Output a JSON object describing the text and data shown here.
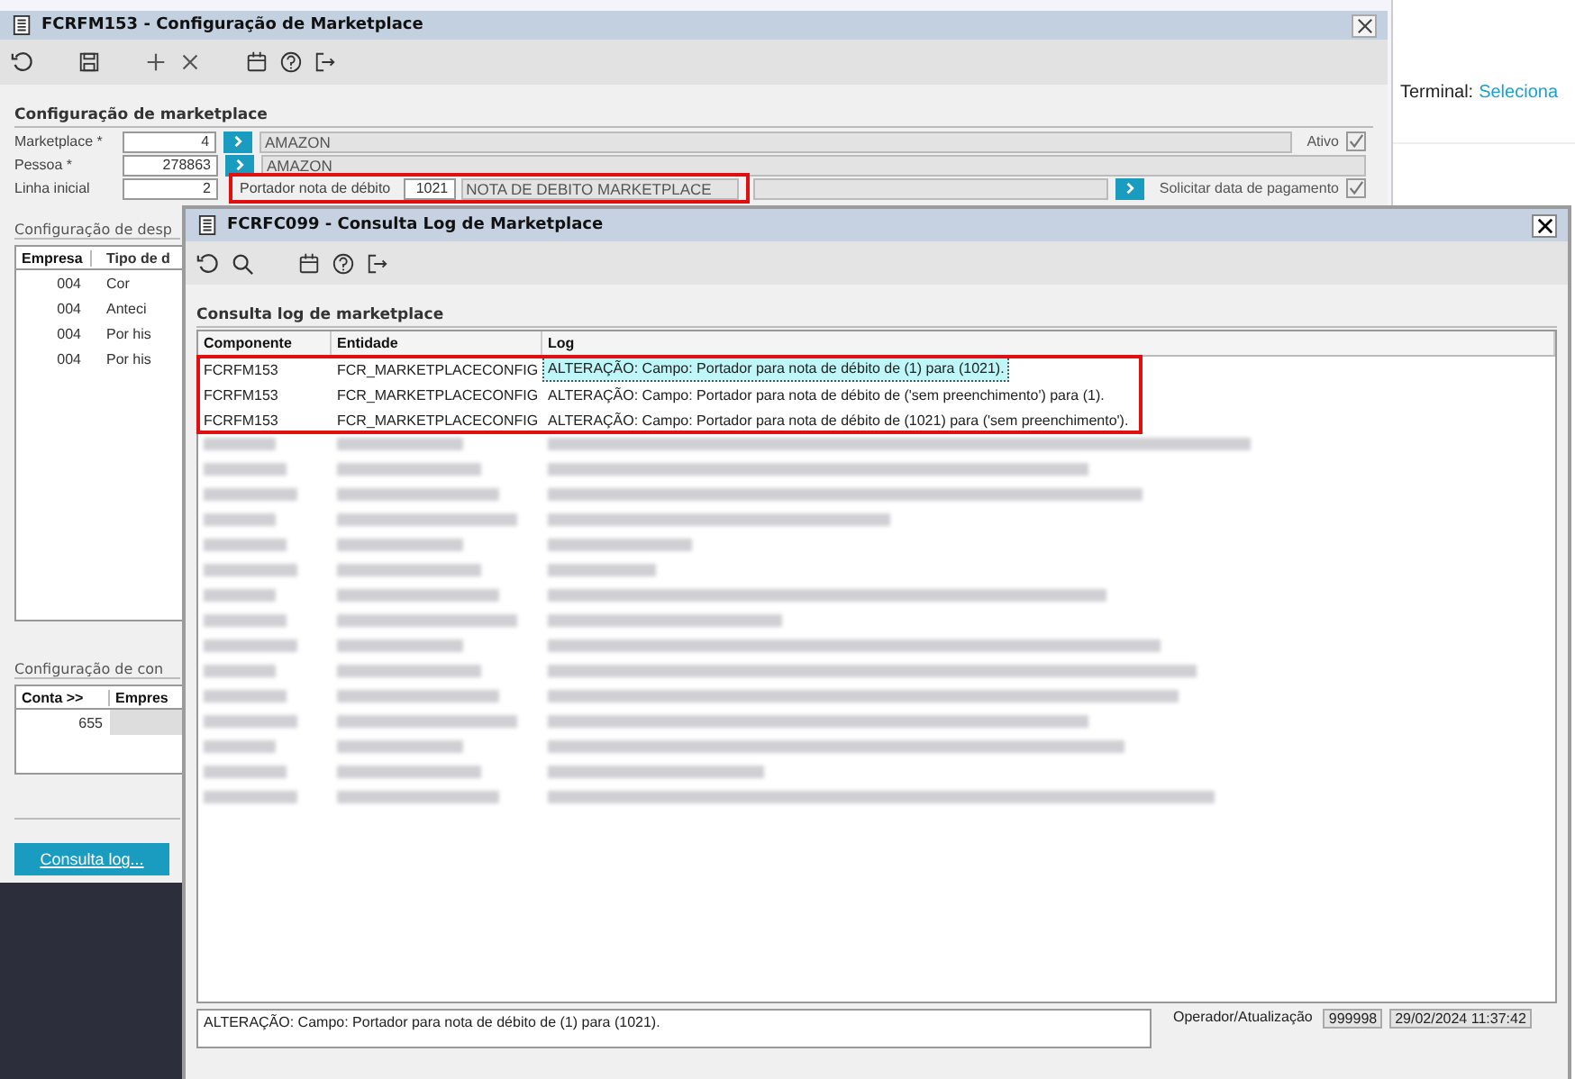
{
  "main_window": {
    "title": "FCRFM153 - Configuração de Marketplace",
    "section_title": "Configuração de marketplace",
    "marketplace": {
      "label": "Marketplace *",
      "value": "4",
      "name": "AMAZON"
    },
    "pessoa": {
      "label": "Pessoa *",
      "value": "278863",
      "name": "AMAZON"
    },
    "linha_inicial": {
      "label": "Linha inicial",
      "value": "2"
    },
    "portador": {
      "label": "Portador nota de débito",
      "value": "1021",
      "name": "NOTA DE DEBITO MARKETPLACE",
      "highlighted": true
    },
    "ativo": {
      "label": "Ativo",
      "checked": true
    },
    "solicitar": {
      "label": "Solicitar data de pagamento",
      "checked": true
    },
    "despesas": {
      "title": "Configuração de desp",
      "columns": [
        "Empresa",
        "Tipo de d"
      ],
      "rows": [
        [
          "004",
          "Cor"
        ],
        [
          "004",
          "Anteci"
        ],
        [
          "004",
          "Por his"
        ],
        [
          "004",
          "Por his"
        ]
      ]
    },
    "contas": {
      "title": "Configuração de con",
      "columns": [
        "Conta >>",
        "Empres"
      ],
      "rows": [
        [
          "655",
          ""
        ]
      ]
    },
    "log_button": "Consulta log..."
  },
  "terminal": {
    "label": "Terminal:",
    "link": "Seleciona"
  },
  "dialog": {
    "title": "FCRFC099 - Consulta Log de Marketplace",
    "section_title": "Consulta log de marketplace",
    "columns": [
      "Componente",
      "Entidade",
      "Log"
    ],
    "rows": [
      {
        "cells": [
          "FCRFM153",
          "FCR_MARKETPLACECONFIG",
          "ALTERAÇÃO: Campo: Portador para nota de débito de (1) para (1021)."
        ],
        "selected": true,
        "highlighted": true
      },
      {
        "cells": [
          "FCRFM153",
          "FCR_MARKETPLACECONFIG",
          "ALTERAÇÃO: Campo: Portador para nota de débito de ('sem preenchimento') para (1)."
        ],
        "selected": false,
        "highlighted": true
      },
      {
        "cells": [
          "FCRFM153",
          "FCR_MARKETPLACECONFIG",
          "ALTERAÇÃO: Campo: Portador para nota de débito de (1021) para ('sem preenchimento')."
        ],
        "selected": false,
        "highlighted": true
      }
    ],
    "blurred_rows": [
      {
        "kind": "blurred"
      },
      {
        "kind": "blurred"
      },
      {
        "kind": "blurred"
      },
      {
        "kind": "blurred"
      },
      {
        "kind": "blurred"
      },
      {
        "kind": "blurred"
      },
      {
        "kind": "blurred"
      },
      {
        "kind": "blurred"
      },
      {
        "kind": "blurred"
      },
      {
        "kind": "blurred"
      },
      {
        "kind": "blurred"
      },
      {
        "kind": "blurred"
      },
      {
        "kind": "blurred"
      },
      {
        "kind": "blurred"
      },
      {
        "kind": "blurred"
      }
    ],
    "detail": "ALTERAÇÃO: Campo: Portador para nota de débito de (1) para (1021).",
    "operator_label": "Operador/Atualização",
    "operator": "999998",
    "timestamp": "29/02/2024 11:37:42"
  }
}
